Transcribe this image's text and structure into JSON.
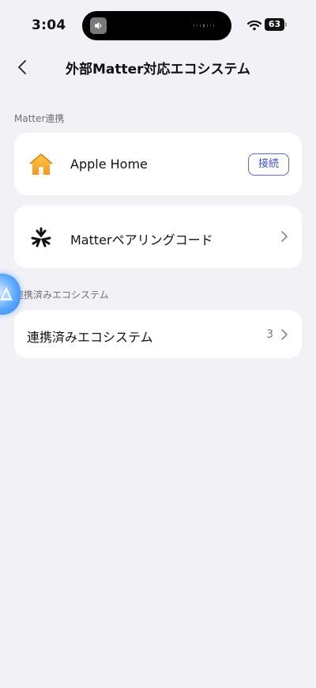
{
  "status_bar": {
    "time": "3:04",
    "battery": "63"
  },
  "nav": {
    "title": "外部Matter対応エコシステム"
  },
  "sections": {
    "matter_link_label": "Matter連携",
    "linked_ecosystems_label": "連携済みエコシステム"
  },
  "apple_home": {
    "label": "Apple Home",
    "connect_label": "接続"
  },
  "matter_pairing": {
    "label": "Matterペアリングコード"
  },
  "linked_ecosystems": {
    "label": "連携済みエコシステム",
    "count": "3"
  },
  "colors": {
    "background": "#f2f2f6",
    "accent": "#3f51c8",
    "home_icon": "#f5a623"
  }
}
